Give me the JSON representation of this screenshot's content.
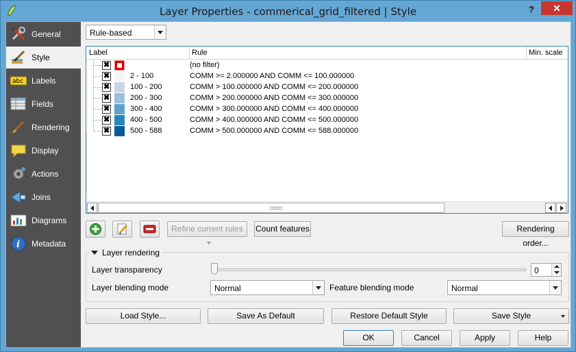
{
  "window": {
    "title": "Layer Properties - commerical_grid_filtered | Style",
    "help_label": "?",
    "close_label": "✕"
  },
  "sidebar": {
    "items": [
      {
        "label": "General",
        "icon": "wrench-screwdriver-icon"
      },
      {
        "label": "Style",
        "icon": "paintbrush-icon",
        "active": true
      },
      {
        "label": "Labels",
        "icon": "abc-label-icon"
      },
      {
        "label": "Fields",
        "icon": "table-fields-icon"
      },
      {
        "label": "Rendering",
        "icon": "brush-rendering-icon"
      },
      {
        "label": "Display",
        "icon": "speech-bubble-icon"
      },
      {
        "label": "Actions",
        "icon": "gear-actions-icon"
      },
      {
        "label": "Joins",
        "icon": "join-arrow-icon"
      },
      {
        "label": "Diagrams",
        "icon": "chart-diagrams-icon"
      },
      {
        "label": "Metadata",
        "icon": "info-icon"
      }
    ]
  },
  "renderer": {
    "selected": "Rule-based"
  },
  "tree": {
    "columns": [
      "Label",
      "Rule",
      "Min. scale"
    ],
    "rows": [
      {
        "label": "",
        "rule": "(no filter)",
        "color": "#ffffff",
        "outline": "#e00000"
      },
      {
        "label": "2 - 100",
        "rule": "COMM >= 2.000000 AND COMM <= 100.000000",
        "color": "#f2f5fa"
      },
      {
        "label": "100 - 200",
        "rule": "COMM > 100.000000 AND COMM <= 200.000000",
        "color": "#c8d4e8"
      },
      {
        "label": "200 - 300",
        "rule": "COMM > 200.000000 AND COMM <= 300.000000",
        "color": "#99bfdc"
      },
      {
        "label": "300 - 400",
        "rule": "COMM > 300.000000 AND COMM <= 400.000000",
        "color": "#5fa1cd"
      },
      {
        "label": "400 - 500",
        "rule": "COMM > 400.000000 AND COMM <= 500.000000",
        "color": "#2a84be"
      },
      {
        "label": "500 - 588",
        "rule": "COMM > 500.000000 AND COMM <= 588.000000",
        "color": "#0c5a98"
      }
    ]
  },
  "toolbar": {
    "add_icon": "add-rule-icon",
    "edit_icon": "edit-rule-icon",
    "remove_icon": "remove-rule-icon",
    "refine_label": "Refine current rules",
    "count_label": "Count features",
    "order_label": "Rendering order..."
  },
  "layer_rendering": {
    "title": "Layer rendering",
    "transparency_label": "Layer transparency",
    "transparency_value": "0",
    "blending_label": "Layer blending mode",
    "blending_value": "Normal",
    "feature_blending_label": "Feature blending mode",
    "feature_blending_value": "Normal"
  },
  "style_buttons": {
    "load": "Load Style...",
    "save_default": "Save As Default",
    "restore": "Restore Default Style",
    "save": "Save Style"
  },
  "dialog_buttons": {
    "ok": "OK",
    "cancel": "Cancel",
    "apply": "Apply",
    "help": "Help"
  }
}
